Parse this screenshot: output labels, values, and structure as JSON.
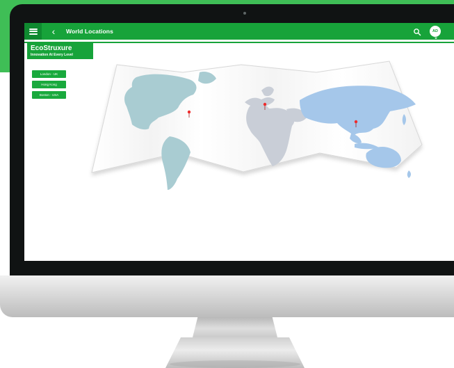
{
  "app": {
    "title": "World Locations",
    "back_symbol": "‹",
    "user_initials": "AD",
    "logo": {
      "brand": "EcoStruxure",
      "tagline": "Innovation At Every Level"
    }
  },
  "toolbar": {
    "menu_icon": "hamburger-menu-icon",
    "back_icon": "chevron-left-icon",
    "search_icon": "search-icon"
  },
  "locations": [
    {
      "label": "London - UK"
    },
    {
      "label": "Hong Kong"
    },
    {
      "label": "Boston - USA"
    }
  ],
  "map": {
    "markers": [
      {
        "name": "london-marker",
        "icon": "location-pin-icon"
      },
      {
        "name": "hong-kong-marker",
        "icon": "location-pin-icon"
      },
      {
        "name": "boston-marker",
        "icon": "location-pin-icon"
      }
    ],
    "colors": {
      "americas": "#a9ccd2",
      "europe_africa": "#c9ced7",
      "asia_pacific": "#a5c7ea",
      "pin": "#ef2b2b"
    }
  },
  "colors": {
    "brand_green": "#17a33a",
    "backdrop_green": "#3fbe56",
    "bezel": "#101313"
  }
}
